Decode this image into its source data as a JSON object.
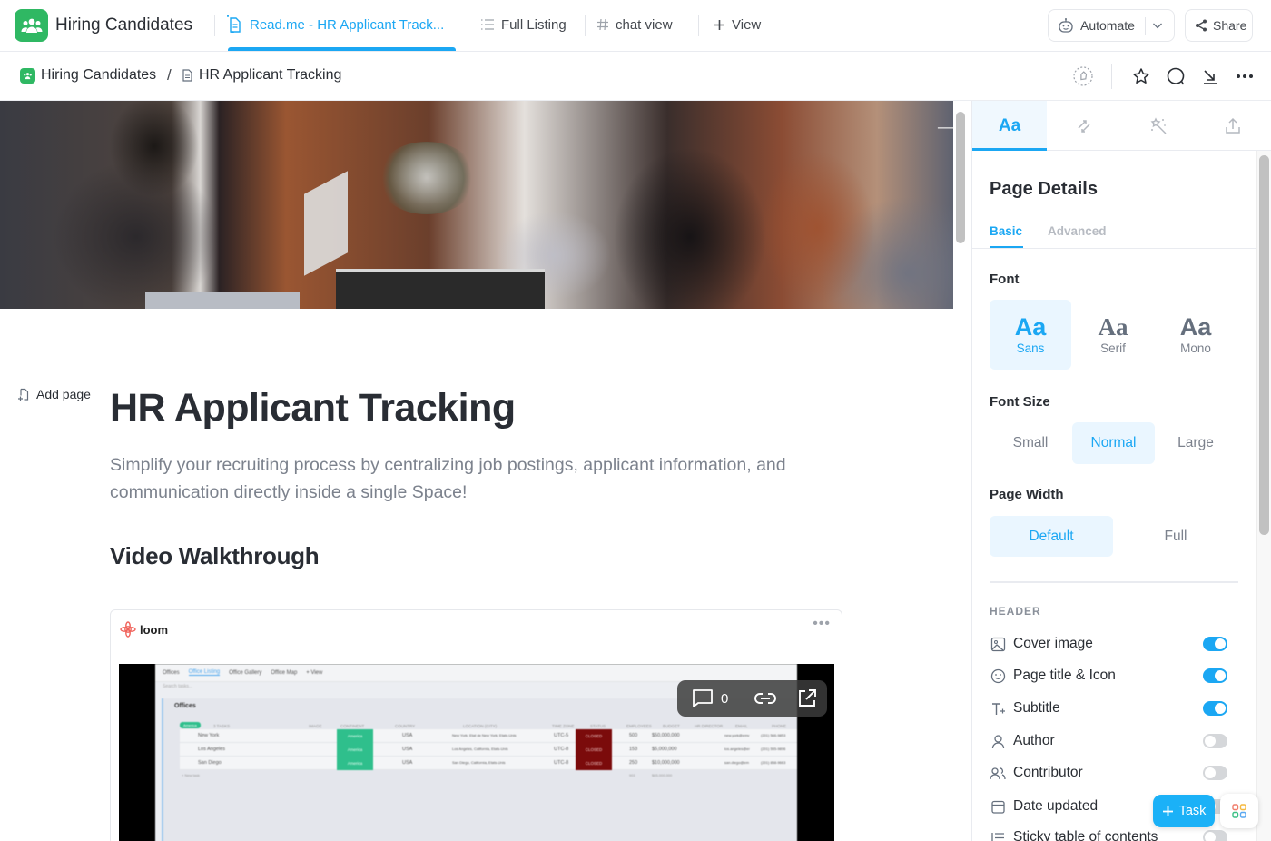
{
  "app": {
    "space_title": "Hiring Candidates",
    "brand_color": "#2fb863",
    "accent_color": "#1ba7f3"
  },
  "tabs": [
    {
      "label": "Read.me - HR Applicant Track...",
      "icon": "doc-icon",
      "active": true
    },
    {
      "label": "Full Listing",
      "icon": "list-icon",
      "active": false
    },
    {
      "label": "chat view",
      "icon": "hash-icon",
      "active": false
    },
    {
      "label": "View",
      "icon": "plus-icon",
      "active": false
    }
  ],
  "header_actions": {
    "automate_label": "Automate",
    "share_label": "Share"
  },
  "breadcrumb": {
    "space": "Hiring Candidates",
    "separator": "/",
    "page": "HR Applicant Tracking"
  },
  "doc": {
    "add_page_label": "Add page",
    "title": "HR Applicant Tracking",
    "subtitle": "Simplify your recruiting process by centralizing job postings, applicant information, and communication directly inside a single Space!",
    "section_heading": "Video Walkthrough",
    "embed": {
      "provider": "loom",
      "comment_count": "0",
      "video_preview": {
        "toolbar": [
          "Offices",
          "Office Listing",
          "Office Gallery",
          "Office Map",
          "+ View"
        ],
        "search_placeholder": "Search tasks...",
        "group_title": "Offices",
        "new_task_label": "+ NEW TASK",
        "group_badge": "America",
        "task_count": "3 TASKS",
        "columns": [
          "IMAGE",
          "CONTINENT",
          "COUNTRY",
          "LOCATION (CITY)",
          "TIME ZONE",
          "STATUS",
          "EMPLOYEES",
          "BUDGET",
          "HR DIRECTOR",
          "EMAIL",
          "PHONE"
        ],
        "rows": [
          {
            "name": "New York",
            "continent": "America",
            "country": "USA",
            "location": "New York, Etat de New York, Etats-Unis",
            "timezone": "UTC-5",
            "status": "CLOSED",
            "employees": "500",
            "budget": "$50,000,000",
            "email": "new.york@emv",
            "phone": "(201) 566-9853"
          },
          {
            "name": "Los Angeles",
            "continent": "America",
            "country": "USA",
            "location": "Los Angeles, California, Etats-Unis",
            "timezone": "UTC-8",
            "status": "CLOSED",
            "employees": "153",
            "budget": "$5,000,000",
            "email": "los.angeles@er",
            "phone": "(201) 555-9896"
          },
          {
            "name": "San Diego",
            "continent": "America",
            "country": "USA",
            "location": "San Diego, California, Etats-Unis",
            "timezone": "UTC-8",
            "status": "CLOSED",
            "employees": "250",
            "budget": "$10,000,000",
            "email": "san.diego@em",
            "phone": "(201) 858-9663"
          }
        ],
        "totals": {
          "employees": "903",
          "budget": "$65,000,000"
        },
        "new_task_row": "+ New task"
      }
    }
  },
  "right_panel": {
    "tabs": [
      {
        "label": "Aa",
        "icon": "typography-icon",
        "active": true
      },
      {
        "label": "",
        "icon": "relations-icon",
        "active": false
      },
      {
        "label": "",
        "icon": "magic-wand-icon",
        "active": false
      },
      {
        "label": "",
        "icon": "export-icon",
        "active": false
      }
    ],
    "title": "Page Details",
    "subtabs": {
      "basic": "Basic",
      "advanced": "Advanced"
    },
    "font": {
      "label": "Font",
      "options": [
        {
          "sample": "Aa",
          "name": "Sans",
          "selected": true
        },
        {
          "sample": "Aa",
          "name": "Serif",
          "selected": false
        },
        {
          "sample": "Aa",
          "name": "Mono",
          "selected": false
        }
      ]
    },
    "font_size": {
      "label": "Font Size",
      "options": [
        "Small",
        "Normal",
        "Large"
      ],
      "selected": "Normal"
    },
    "page_width": {
      "label": "Page Width",
      "options": [
        "Default",
        "Full"
      ],
      "selected": "Default"
    },
    "header_section": {
      "label": "HEADER",
      "items": [
        {
          "label": "Cover image",
          "icon": "image-icon",
          "on": true
        },
        {
          "label": "Page title & Icon",
          "icon": "smiley-icon",
          "on": true
        },
        {
          "label": "Subtitle",
          "icon": "text-plus-icon",
          "on": true
        },
        {
          "label": "Author",
          "icon": "user-icon",
          "on": false
        },
        {
          "label": "Contributor",
          "icon": "users-icon",
          "on": false
        },
        {
          "label": "Date updated",
          "icon": "calendar-icon",
          "on": false
        },
        {
          "label": "Sticky table of contents",
          "icon": "list-icon",
          "on": false
        }
      ]
    }
  },
  "fab": {
    "task_label": "Task"
  }
}
